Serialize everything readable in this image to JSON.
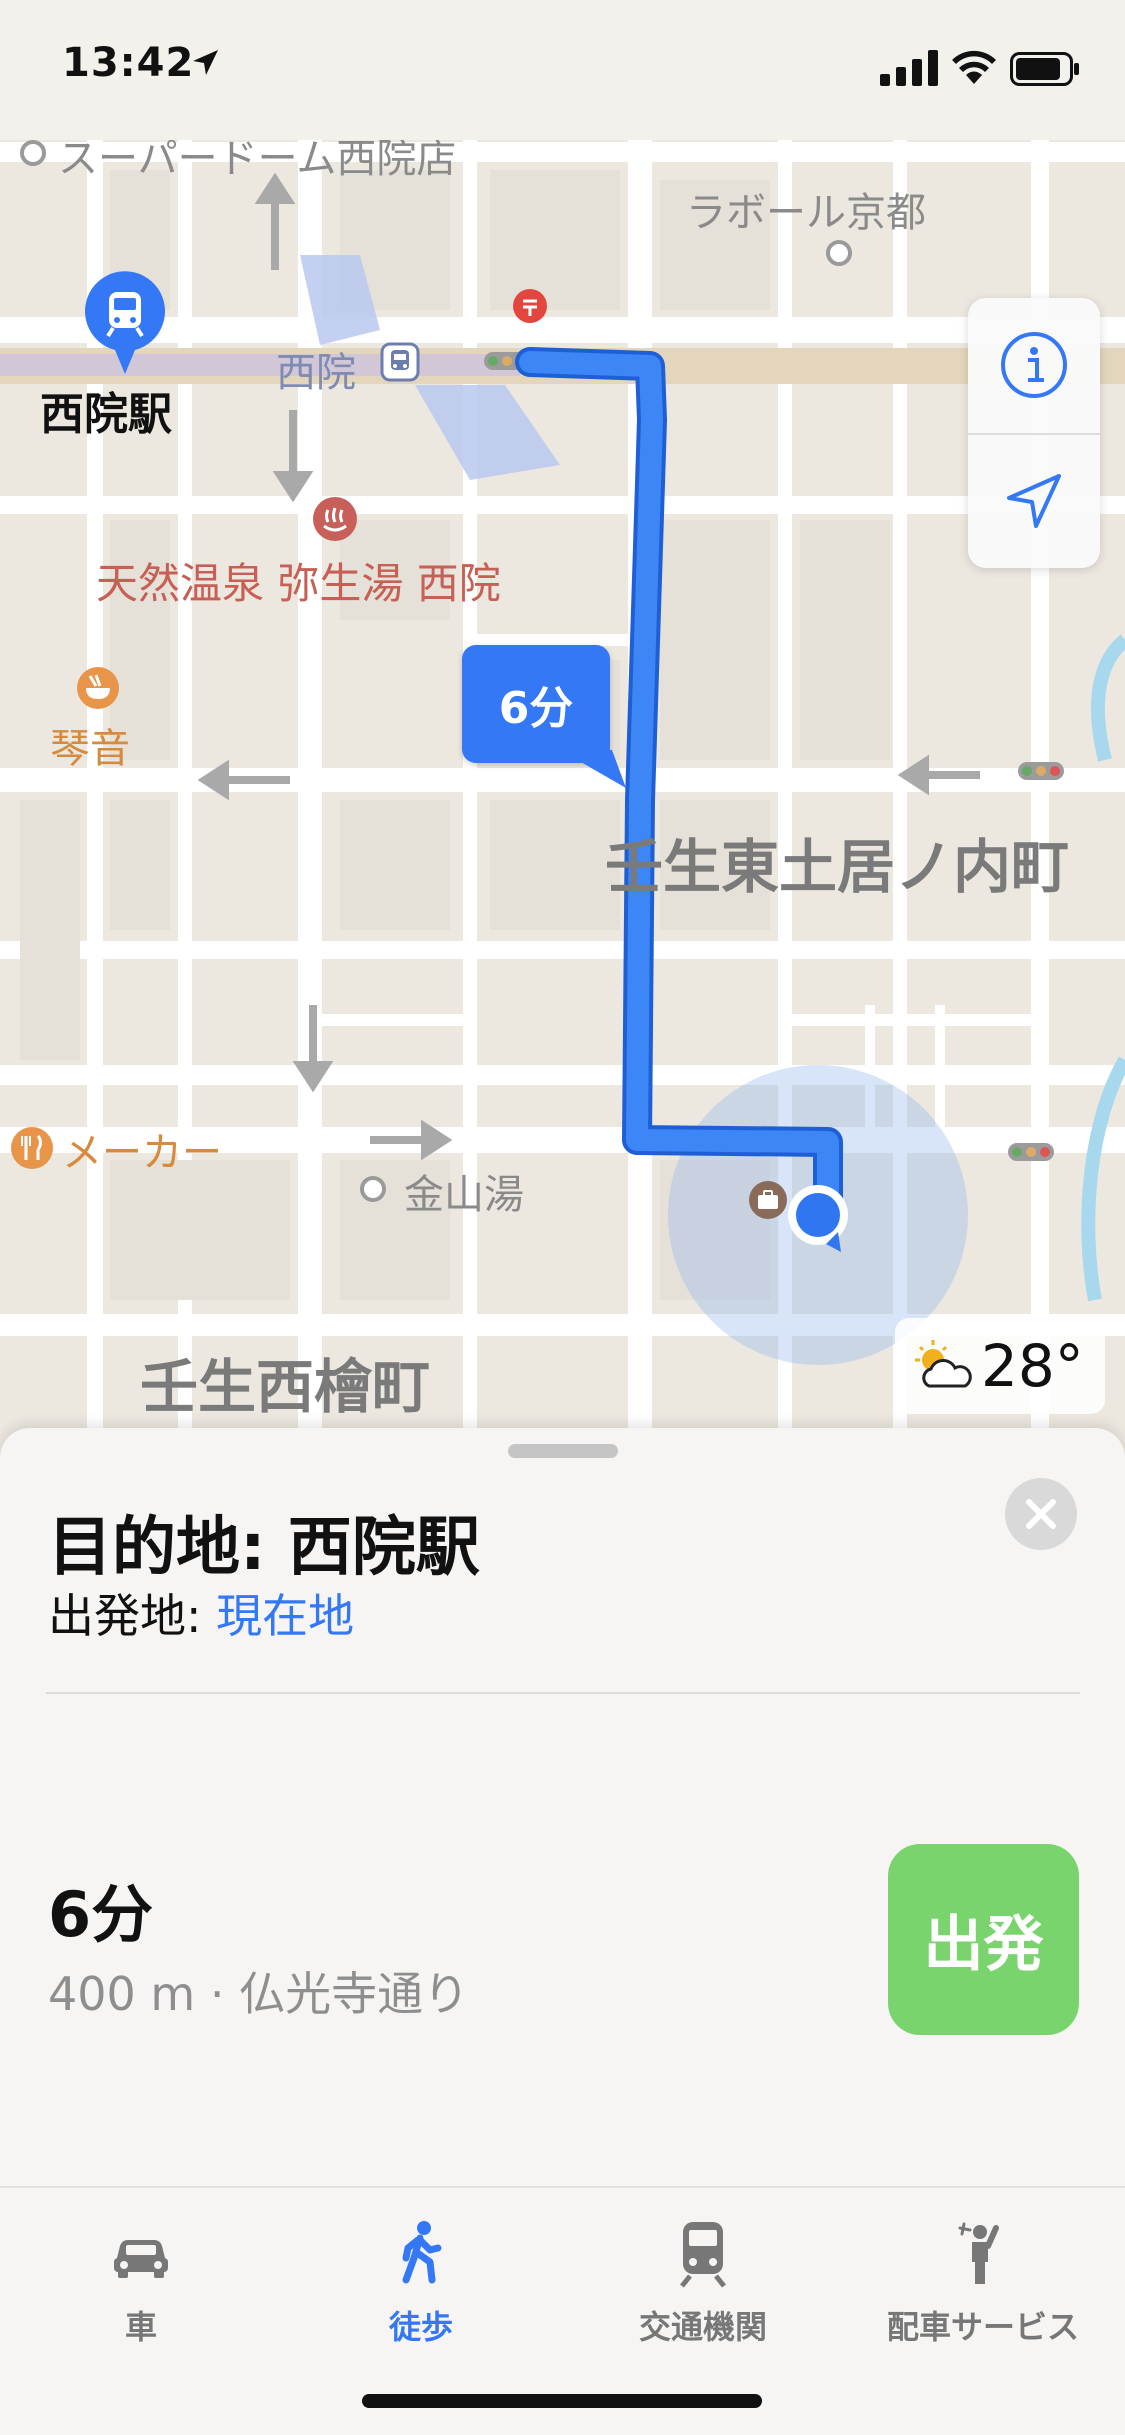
{
  "status_bar": {
    "time": "13:42",
    "icons": [
      "location-arrow-icon",
      "signal-icon",
      "wifi-icon",
      "battery-icon"
    ]
  },
  "map": {
    "labels": {
      "superdome": "スーパードーム西院店",
      "labor": "ラボール京都",
      "station_pin": "西院駅",
      "station_line": "西院",
      "onsen": "天然温泉 弥生湯 西院",
      "kotone": "琴音",
      "district_east": "壬生東土居ノ内町",
      "maker": "メーカー",
      "kanayama": "金山湯",
      "district_west": "壬生西檜町"
    },
    "route_eta": "6分",
    "weather_temp": "28°",
    "colors": {
      "route": "#3478f6",
      "rail": "#d9c9a8",
      "water": "#a8d8ee"
    }
  },
  "sheet": {
    "destination": "目的地: 西院駅",
    "origin_label": "出発地: ",
    "origin_value": "現在地",
    "route_time": "6分",
    "route_detail": "400 m · 仏光寺通り",
    "go_label": "出発"
  },
  "tabs": [
    {
      "label": "車",
      "icon": "car-icon",
      "active": false
    },
    {
      "label": "徒歩",
      "icon": "walking-icon",
      "active": true
    },
    {
      "label": "交通機関",
      "icon": "train-icon",
      "active": false
    },
    {
      "label": "配車サービス",
      "icon": "hail-icon",
      "active": false
    }
  ]
}
